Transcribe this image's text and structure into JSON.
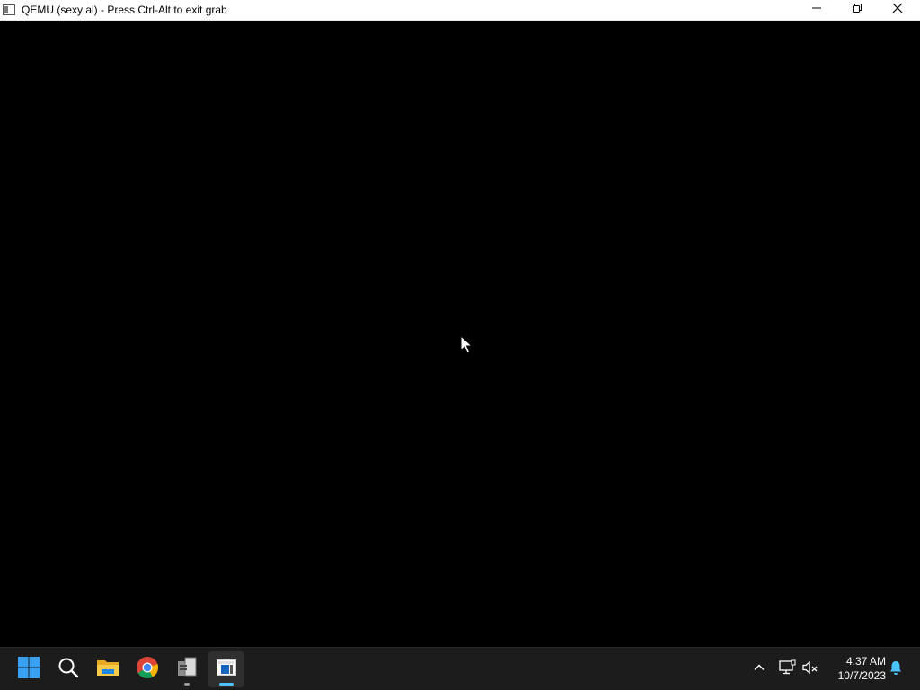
{
  "window": {
    "title": "QEMU (sexy ai) - Press Ctrl-Alt to exit grab",
    "icon": "qemu-monitor-icon",
    "controls": {
      "minimize": "minimize-icon",
      "restore": "restore-icon",
      "close": "close-icon"
    }
  },
  "screen": {
    "background": "#000000",
    "cursor": "mouse-pointer-icon"
  },
  "taskbar": {
    "background": "#1c1c1c",
    "apps": [
      {
        "name": "Start",
        "icon": "windows-start-icon"
      },
      {
        "name": "Search",
        "icon": "search-icon"
      },
      {
        "name": "File Explorer",
        "icon": "folder-icon"
      },
      {
        "name": "Google Chrome",
        "icon": "chrome-icon"
      },
      {
        "name": "Application",
        "icon": "tool-app-icon"
      },
      {
        "name": "QEMU",
        "icon": "qemu-taskbar-icon"
      }
    ],
    "tray": {
      "show_hidden": "chevron-up-icon",
      "network": "network-icon",
      "volume": "volume-muted-icon",
      "notifications": "bell-icon"
    },
    "clock": {
      "time": "4:37 AM",
      "date": "10/7/2023"
    },
    "accent": "#4cc2ff"
  }
}
